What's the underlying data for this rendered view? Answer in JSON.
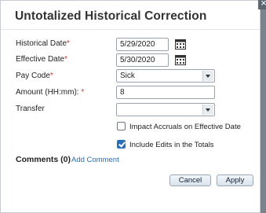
{
  "dialog": {
    "title": "Untotalized Historical Correction",
    "close_icon": "close-icon"
  },
  "form": {
    "historical_date": {
      "label": "Historical Date",
      "required_mark": "*",
      "value": "5/29/2020",
      "icon": "calendar-icon"
    },
    "effective_date": {
      "label": "Effective Date",
      "required_mark": "*",
      "value": "5/30/2020",
      "icon": "calendar-icon"
    },
    "pay_code": {
      "label": "Pay Code",
      "required_mark": "*",
      "value": "Sick"
    },
    "amount": {
      "label": "Amount (HH:mm): ",
      "required_mark": "*",
      "value": "8"
    },
    "transfer": {
      "label": "Transfer",
      "value": ""
    },
    "impact_accruals": {
      "label": "Impact Accruals on Effective Date",
      "checked": false
    },
    "include_edits": {
      "label": "Include Edits in the Totals",
      "checked": true
    }
  },
  "comments": {
    "label": "Comments (0)",
    "add_label": "Add Comment"
  },
  "buttons": {
    "cancel": "Cancel",
    "apply": "Apply"
  },
  "colors": {
    "accent": "#2b6fb6",
    "required": "#c0392b"
  }
}
